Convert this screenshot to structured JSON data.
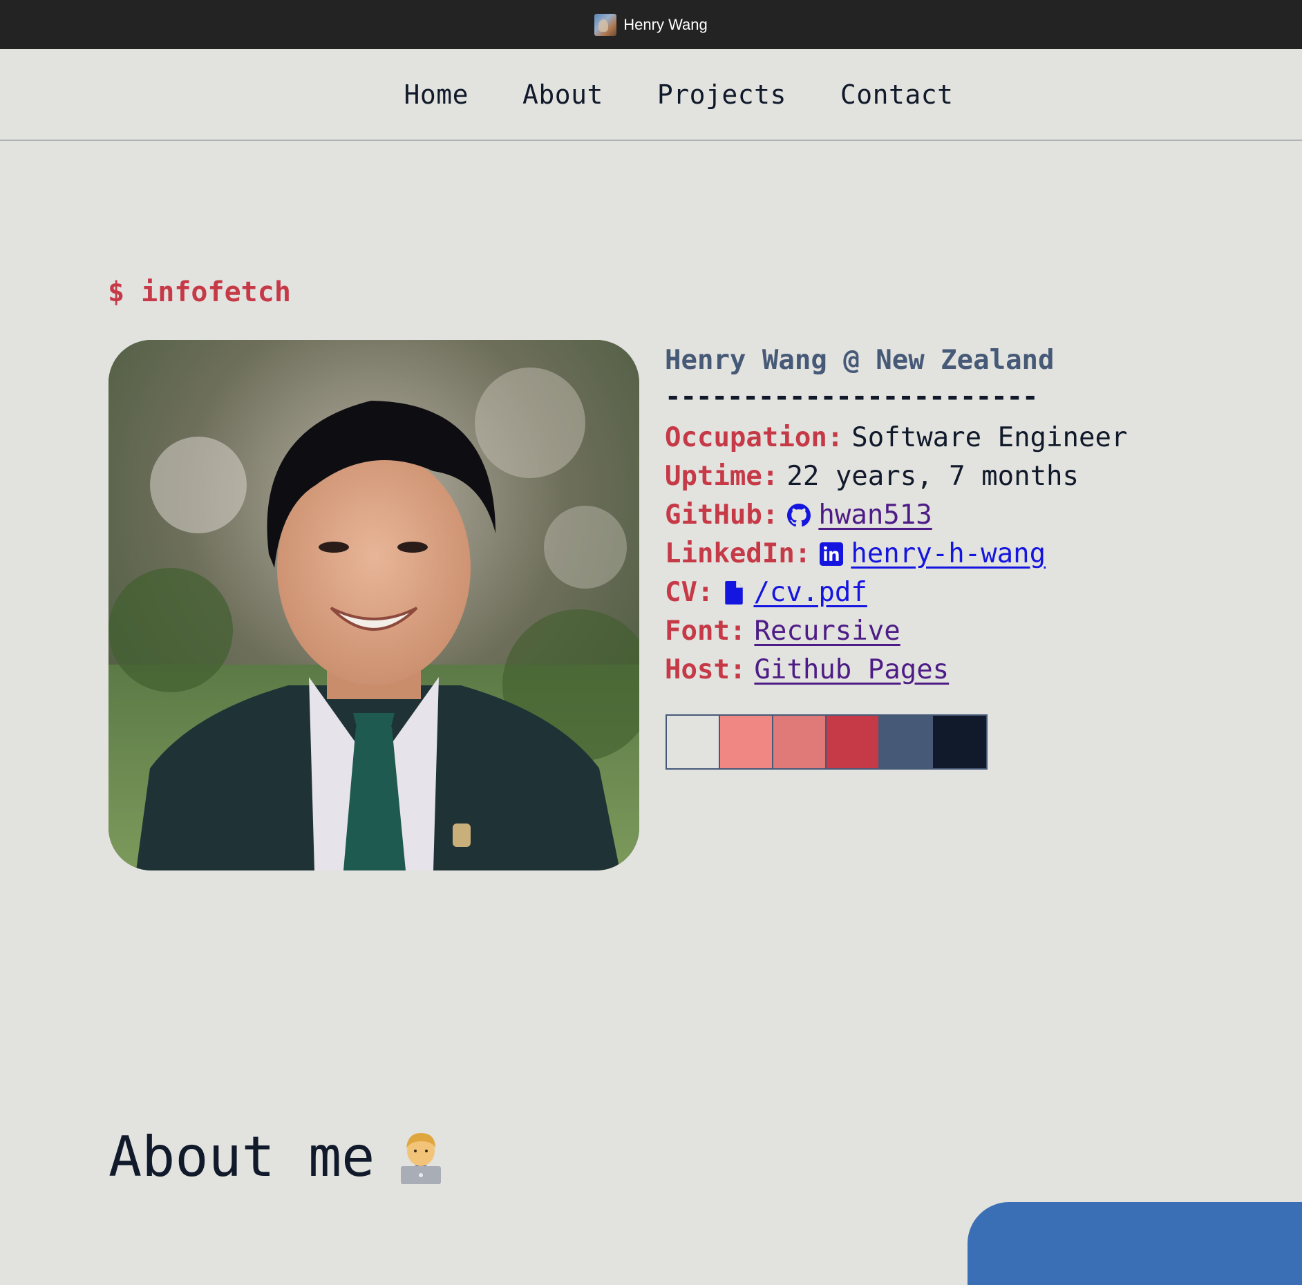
{
  "window": {
    "title": "Henry Wang"
  },
  "nav": {
    "items": [
      {
        "label": "Home"
      },
      {
        "label": "About"
      },
      {
        "label": "Projects"
      },
      {
        "label": "Contact"
      }
    ]
  },
  "hero": {
    "prompt": "$ infofetch",
    "heading": "Henry Wang @ New Zealand",
    "rule": "------------------------",
    "rows": {
      "occupation": {
        "key": "Occupation:",
        "value": "Software Engineer"
      },
      "uptime": {
        "key": "Uptime:",
        "value": "22 years, 7 months"
      },
      "github": {
        "key": "GitHub:",
        "value": "hwan513",
        "icon": "github-icon"
      },
      "linkedin": {
        "key": "LinkedIn:",
        "value": "henry-h-wang",
        "icon": "linkedin-icon"
      },
      "cv": {
        "key": "CV:",
        "value": "/cv.pdf",
        "icon": "file-icon"
      },
      "font": {
        "key": "Font:",
        "value": "Recursive"
      },
      "host": {
        "key": "Host:",
        "value": "Github Pages"
      }
    },
    "palette": [
      "#e2e2de",
      "#f08783",
      "#e07a78",
      "#c63a48",
      "#465a78",
      "#111a2b"
    ]
  },
  "about": {
    "heading": "About me",
    "emoji": "technologist-emoji"
  },
  "colors": {
    "background": "#e2e2de",
    "accent_red": "#c63a48",
    "accent_slate": "#465a78",
    "text_dark": "#111a2b",
    "link_blue": "#1515e0",
    "link_visited": "#4e1c86"
  }
}
